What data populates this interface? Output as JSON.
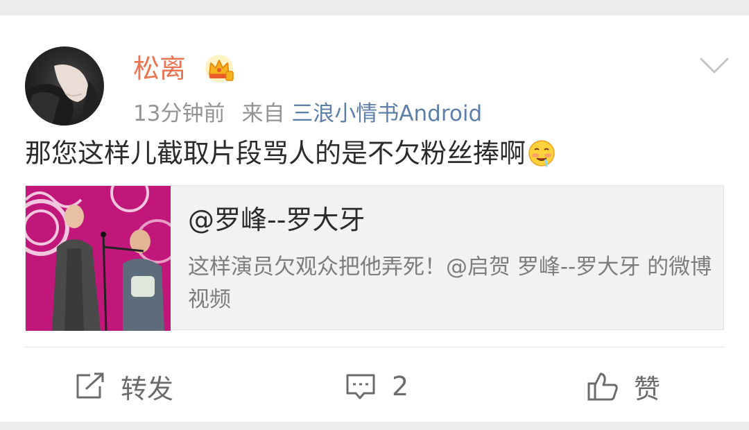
{
  "post": {
    "author": {
      "name": "松离",
      "avatar_icon": "avatar-hand-icon",
      "badge_icon": "vip-crown-icon"
    },
    "meta": {
      "time": "13分钟前",
      "from_label": "来自",
      "source": "三浪小情书Android"
    },
    "menu_icon": "chevron-down-icon",
    "text": "那您这样儿截取片段骂人的是不欠粉丝捧啊",
    "text_emoji_icon": "emoji-drooling-icon"
  },
  "repost": {
    "thumbnail_icon": "video-thumbnail",
    "title": "@罗峰--罗大牙",
    "desc": "这样演员欠观众把他弄死！@启贺 罗峰--罗大牙 的微博视频"
  },
  "actions": {
    "repost_label": "转发",
    "comment_count": "2",
    "like_label": "赞"
  },
  "colors": {
    "username": "#eb7350",
    "source_link": "#5b7fa8",
    "meta": "#939393",
    "repost_bg": "#f2f2f2"
  }
}
